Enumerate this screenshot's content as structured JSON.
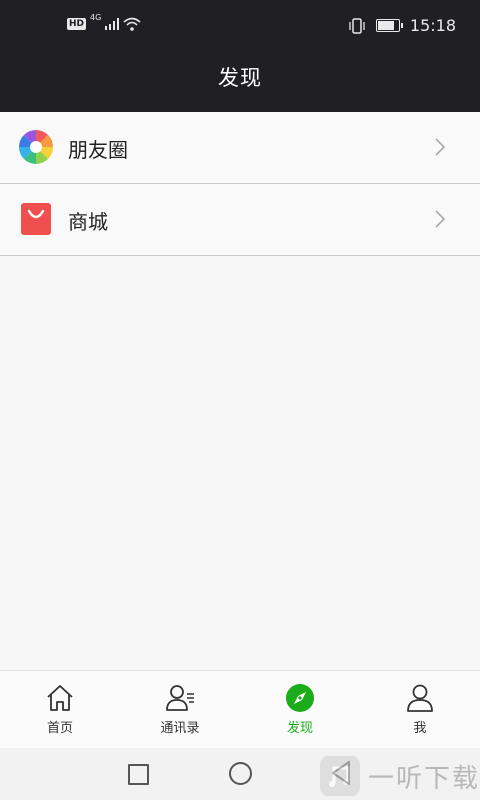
{
  "status_bar": {
    "hd": "HD",
    "network": "4G",
    "time": "15:18",
    "battery_level": 0.75
  },
  "header": {
    "title": "发现"
  },
  "list": {
    "items": [
      {
        "label": "朋友圈",
        "icon": "moments-aperture-icon"
      },
      {
        "label": "商城",
        "icon": "shopping-bag-icon"
      }
    ]
  },
  "tabbar": {
    "tabs": [
      {
        "label": "首页",
        "icon": "home-icon",
        "active": false
      },
      {
        "label": "通讯录",
        "icon": "contacts-icon",
        "active": false
      },
      {
        "label": "发现",
        "icon": "compass-icon",
        "active": true
      },
      {
        "label": "我",
        "icon": "person-icon",
        "active": false
      }
    ],
    "active_color": "#1aad19"
  },
  "watermark": {
    "text": "一听下载"
  },
  "colors": {
    "header_bg": "#1f1f24",
    "bag_red": "#ef4f4f",
    "accent_green": "#1aad19"
  }
}
